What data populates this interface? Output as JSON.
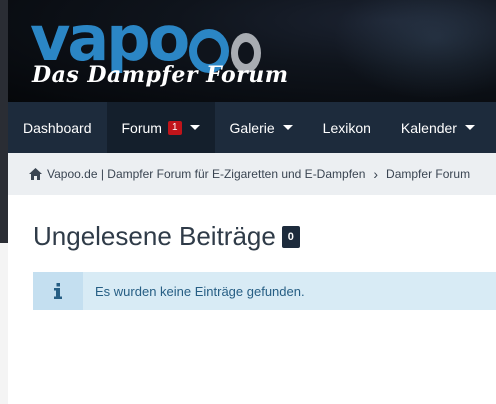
{
  "header": {
    "logo_main": "vapo",
    "tagline": "Das Dampfer Forum"
  },
  "nav": {
    "items": [
      {
        "label": "Dashboard",
        "active": false,
        "dropdown": false
      },
      {
        "label": "Forum",
        "active": true,
        "dropdown": true,
        "badge": "1"
      },
      {
        "label": "Galerie",
        "active": false,
        "dropdown": true
      },
      {
        "label": "Lexikon",
        "active": false,
        "dropdown": false
      },
      {
        "label": "Kalender",
        "active": false,
        "dropdown": true
      }
    ]
  },
  "breadcrumb": {
    "home_icon": "home-icon",
    "items": [
      "Vapoo.de | Dampfer Forum für E-Zigaretten und E-Dampfen",
      "Dampfer Forum"
    ]
  },
  "main": {
    "title": "Ungelesene Beiträge",
    "count": "0",
    "info_icon": "info-icon",
    "info_text": "Es wurden keine Einträge gefunden."
  },
  "colors": {
    "brand_blue": "#2b86c5",
    "nav_bg": "#1d2b3c",
    "badge_red": "#c0141a",
    "info_bg": "#d8ebf5"
  }
}
